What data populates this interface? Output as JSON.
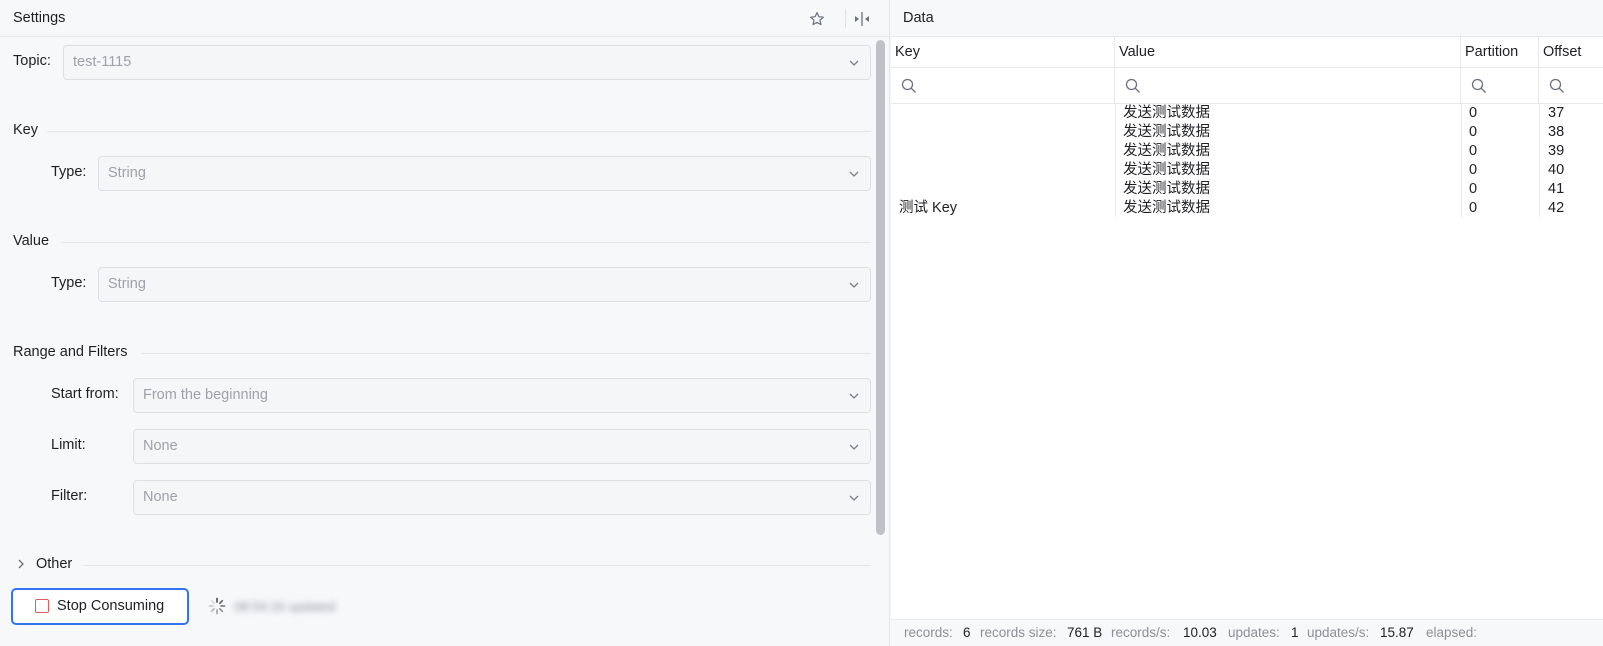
{
  "settings": {
    "title": "Settings",
    "topic": {
      "label": "Topic:",
      "value": "test-1115"
    },
    "key": {
      "section": "Key",
      "type_label": "Type:",
      "type_value": "String"
    },
    "value": {
      "section": "Value",
      "type_label": "Type:",
      "type_value": "String"
    },
    "range": {
      "section": "Range and Filters",
      "start_label": "Start from:",
      "start_value": "From the beginning",
      "limit_label": "Limit:",
      "limit_value": "None",
      "filter_label": "Filter:",
      "filter_value": "None"
    },
    "other": {
      "label": "Other"
    },
    "stop_button": "Stop Consuming",
    "status": "08:54:16 updated"
  },
  "data": {
    "title": "Data",
    "columns": [
      "Key",
      "Value",
      "Partition",
      "Offset"
    ],
    "rows": [
      {
        "key": "",
        "value": "发送测试数据",
        "partition": "0",
        "offset": "37"
      },
      {
        "key": "",
        "value": "发送测试数据",
        "partition": "0",
        "offset": "38"
      },
      {
        "key": "",
        "value": "发送测试数据",
        "partition": "0",
        "offset": "39"
      },
      {
        "key": "",
        "value": "发送测试数据",
        "partition": "0",
        "offset": "40"
      },
      {
        "key": "",
        "value": "发送测试数据",
        "partition": "0",
        "offset": "41"
      },
      {
        "key": "测试 Key",
        "value": "发送测试数据",
        "partition": "0",
        "offset": "42"
      }
    ]
  },
  "footer": {
    "records_label": "records:",
    "records": "6",
    "size_label": "records size:",
    "size": "761 B",
    "rps_label": "records/s:",
    "rps": "10.03",
    "updates_label": "updates:",
    "updates": "1",
    "ups_label": "updates/s:",
    "ups": "15.87",
    "elapsed_label": "elapsed:"
  },
  "icons": {
    "favorite": "star-icon",
    "layout": "split-layout-icon",
    "dropdown": "chevron-down-icon",
    "expand": "chevron-right-icon",
    "filter": "search-icon",
    "loading": "spinner-icon"
  },
  "colors": {
    "accent": "#3574f0",
    "stop": "#db5c5c"
  }
}
